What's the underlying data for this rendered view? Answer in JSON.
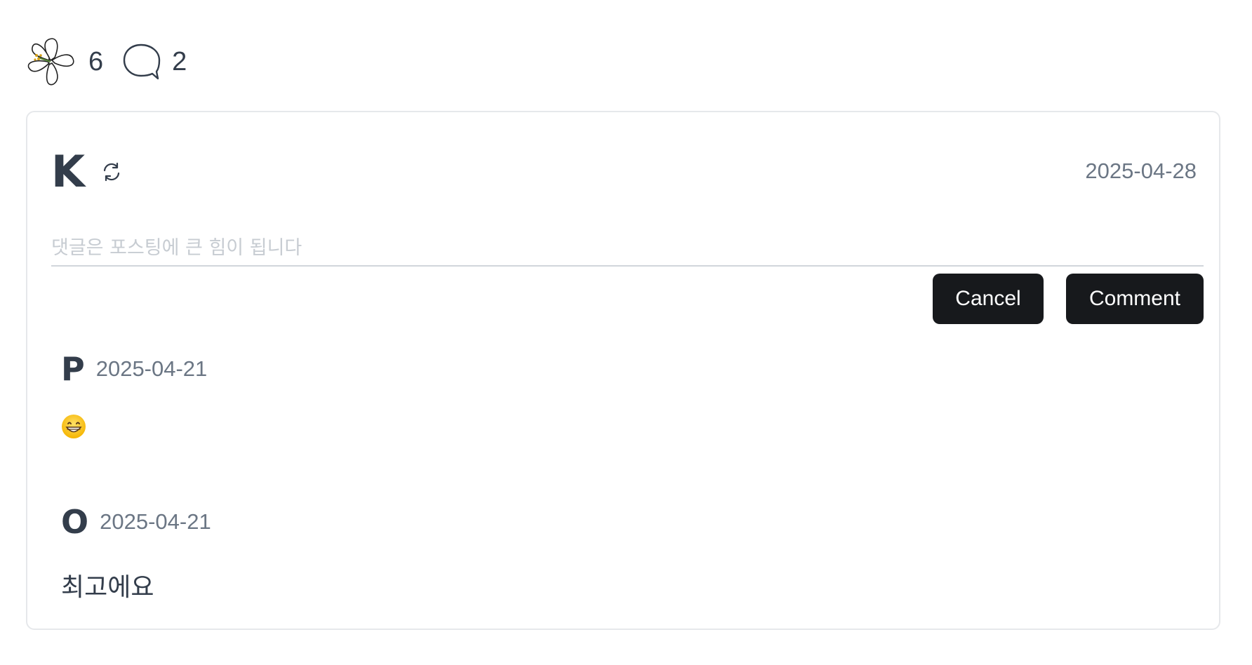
{
  "stats": {
    "flower_count": "6",
    "comment_count": "2"
  },
  "composer": {
    "avatar_letter": "K",
    "date": "2025-04-28",
    "placeholder": "댓글은 포스팅에 큰 힘이 됩니다",
    "cancel_label": "Cancel",
    "comment_label": "Comment"
  },
  "comments": [
    {
      "avatar_letter": "P",
      "date": "2025-04-21",
      "body_icon": "grinning-face-emoji"
    },
    {
      "avatar_letter": "O",
      "date": "2025-04-21",
      "body": "최고에요"
    }
  ],
  "colors": {
    "text": "#333d4b",
    "muted": "#6b7684",
    "button_bg": "#17191c",
    "border": "#e6e8eb"
  }
}
